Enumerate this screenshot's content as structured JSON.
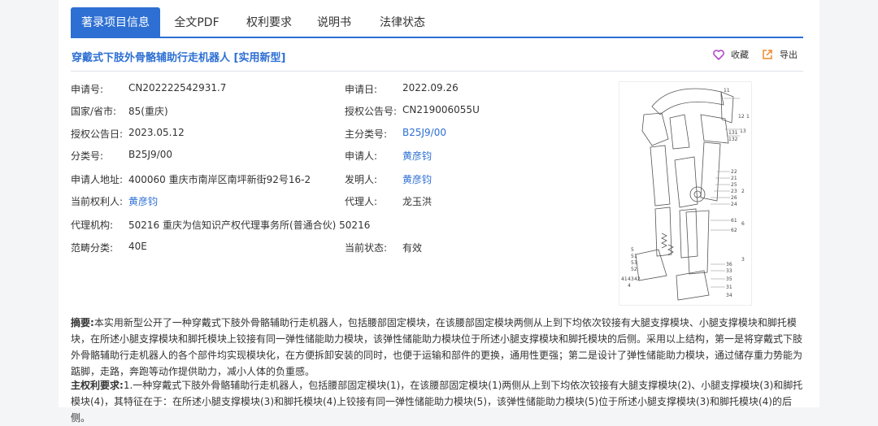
{
  "tabs": [
    {
      "label": "著录项目信息",
      "active": true
    },
    {
      "label": "全文PDF"
    },
    {
      "label": "权利要求"
    },
    {
      "label": "说明书"
    },
    {
      "label": "法律状态"
    }
  ],
  "patent": {
    "title": "穿戴式下肢外骨骼辅助行走机器人 [实用新型]",
    "actions": {
      "favorite": "收藏",
      "export": "导出"
    }
  },
  "fields": {
    "application_no": {
      "label": "申请号:",
      "value": "CN202222542931.7"
    },
    "application_date": {
      "label": "申请日:",
      "value": "2022.09.26"
    },
    "country": {
      "label": "国家/省市:",
      "value": "85(重庆)"
    },
    "grant_pub_no": {
      "label": "授权公告号:",
      "value": "CN219006055U"
    },
    "grant_pub_date": {
      "label": "授权公告日:",
      "value": "2023.05.12"
    },
    "main_class": {
      "label": "主分类号:",
      "value": "B25J9/00"
    },
    "class_no": {
      "label": "分类号:",
      "value": "B25J9/00"
    },
    "applicant": {
      "label": "申请人:",
      "value": "黄彦钧"
    },
    "applicant_address": {
      "label": "申请人地址:",
      "value": "400060 重庆市南岸区南坪新街92号16-2"
    },
    "inventor": {
      "label": "发明人:",
      "value": "黄彦钧"
    },
    "current_holder": {
      "label": "当前权利人:",
      "value": "黄彦钧"
    },
    "agent": {
      "label": "代理人:",
      "value": "龙玉洪"
    },
    "agency": {
      "label": "代理机构:",
      "value": "50216 重庆为信知识产权代理事务所(普通合伙) 50216"
    },
    "category": {
      "label": "范畴分类:",
      "value": "40E"
    },
    "current_status": {
      "label": "当前状态:",
      "value": "有效"
    }
  },
  "figure_labels": [
    "11",
    "12",
    "1",
    "131",
    "13",
    "132",
    "22",
    "21",
    "25",
    "23",
    "2",
    "26",
    "24",
    "61",
    "6",
    "62",
    "5",
    "51",
    "53",
    "52",
    "3",
    "36",
    "33",
    "35",
    "31",
    "34",
    "41",
    "43",
    "42",
    "4"
  ],
  "abstract": {
    "label": "摘要:",
    "text": "本实用新型公开了一种穿戴式下肢外骨骼辅助行走机器人，包括腰部固定模块，在该腰部固定模块两侧从上到下均依次铰接有大腿支撑模块、小腿支撑模块和脚托模块，在所述小腿支撑模块和脚托模块上铰接有同一弹性储能助力模块，该弹性储能助力模块位于所述小腿支撑模块和脚托模块的后侧。采用以上结构，第一是将穿戴式下肢外骨骼辅助行走机器人的各个部件均实现模块化，在方便拆卸安装的同时，也便于运输和部件的更换，通用性更强；第二是设计了弹性储能助力模块，通过储存重力势能为踮脚，走路，奔跑等动作提供助力，减小人体的负重感。"
  },
  "claim": {
    "label": "主权利要求:",
    "text": "1.一种穿戴式下肢外骨骼辅助行走机器人，包括腰部固定模块(1)，在该腰部固定模块(1)两侧从上到下均依次铰接有大腿支撑模块(2)、小腿支撑模块(3)和脚托模块(4)，其特征在于：在所述小腿支撑模块(3)和脚托模块(4)上铰接有同一弹性储能助力模块(5)，该弹性储能助力模块(5)位于所述小腿支撑模块(3)和脚托模块(4)的后侧。"
  }
}
